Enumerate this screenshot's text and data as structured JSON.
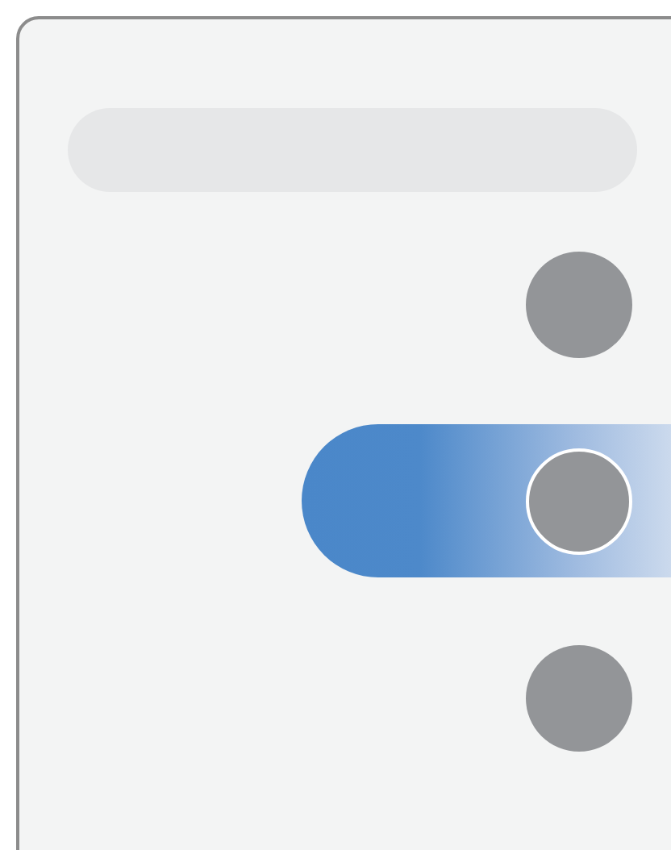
{
  "items": [
    {
      "selected": false
    },
    {
      "selected": true
    },
    {
      "selected": false
    }
  ]
}
